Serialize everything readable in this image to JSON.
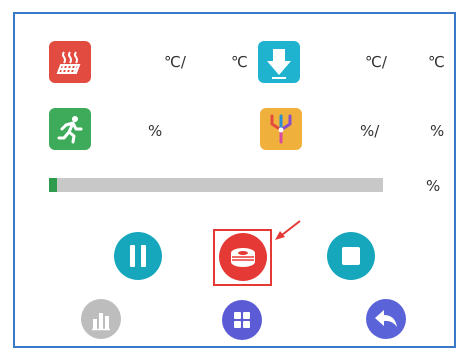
{
  "status": {
    "hotbed": {
      "icon": "hotbed-heater-icon",
      "current": "",
      "target": "",
      "sep_unit": "℃/",
      "unit": "℃"
    },
    "nozzle": {
      "icon": "nozzle-temperature-icon",
      "current": "",
      "target": "",
      "sep_unit": "℃/",
      "unit": "℃"
    },
    "speed": {
      "icon": "print-speed-running-icon",
      "value": "",
      "unit": "%"
    },
    "extruder": {
      "icon": "extruder-flow-icon",
      "value": "",
      "sep_unit": "%/",
      "unit": "%"
    }
  },
  "progress": {
    "percent_label": "%",
    "fraction": 0.025
  },
  "controls": {
    "pause": {
      "icon": "pause-icon"
    },
    "filament": {
      "icon": "filament-spool-icon"
    },
    "stop": {
      "icon": "stop-icon"
    }
  },
  "bottom_bar": {
    "stats": {
      "icon": "bar-chart-icon"
    },
    "menu": {
      "icon": "grid-menu-icon"
    },
    "back": {
      "icon": "back-arrow-icon"
    }
  },
  "colors": {
    "frame": "#3a78c8",
    "hotbed": "#e24b3f",
    "nozzle": "#1fb3cf",
    "speed": "#3dab5a",
    "extruder": "#efb13c",
    "teal_button": "#16a7bd",
    "filament_button": "#e53935",
    "highlight": "#e53935",
    "stats_disabled": "#bdbdbd",
    "menu_button": "#5b5bd6",
    "back_button": "#5b63d9",
    "progress_fill": "#2e9b4d",
    "progress_track": "#c8c8c8"
  }
}
